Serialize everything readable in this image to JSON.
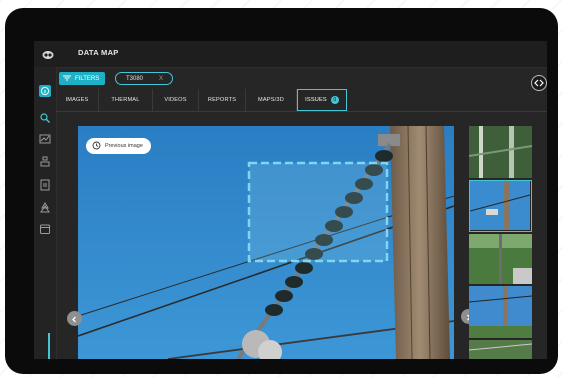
{
  "app": {
    "title": "DATA MAP",
    "logo_icon": "app-logo-icon"
  },
  "rail": {
    "items": [
      {
        "name": "info-icon",
        "active": true
      },
      {
        "name": "search-issue-icon",
        "active": false
      },
      {
        "name": "chart-icon",
        "active": false
      },
      {
        "name": "structure-icon",
        "active": false
      },
      {
        "name": "document-icon",
        "active": false
      },
      {
        "name": "vegetation-icon",
        "active": false
      },
      {
        "name": "calendar-icon",
        "active": false
      }
    ]
  },
  "filters": {
    "button_label": "FILTERS",
    "chip_label": "T3080",
    "chip_remove": "X"
  },
  "tabs": [
    {
      "label": "IMAGES"
    },
    {
      "label": "THERMAL"
    },
    {
      "label": "VIDEOS"
    },
    {
      "label": "REPORTS"
    },
    {
      "label": "MAPS/3D"
    },
    {
      "label": "ISSUES",
      "badge": "0",
      "active": true
    }
  ],
  "viewer": {
    "previous_label": "Previous image"
  },
  "colors": {
    "accent": "#43c7d6",
    "filter_button": "#1eb1c6",
    "sky": "#2f86c9",
    "screen_bg": "#262626"
  }
}
